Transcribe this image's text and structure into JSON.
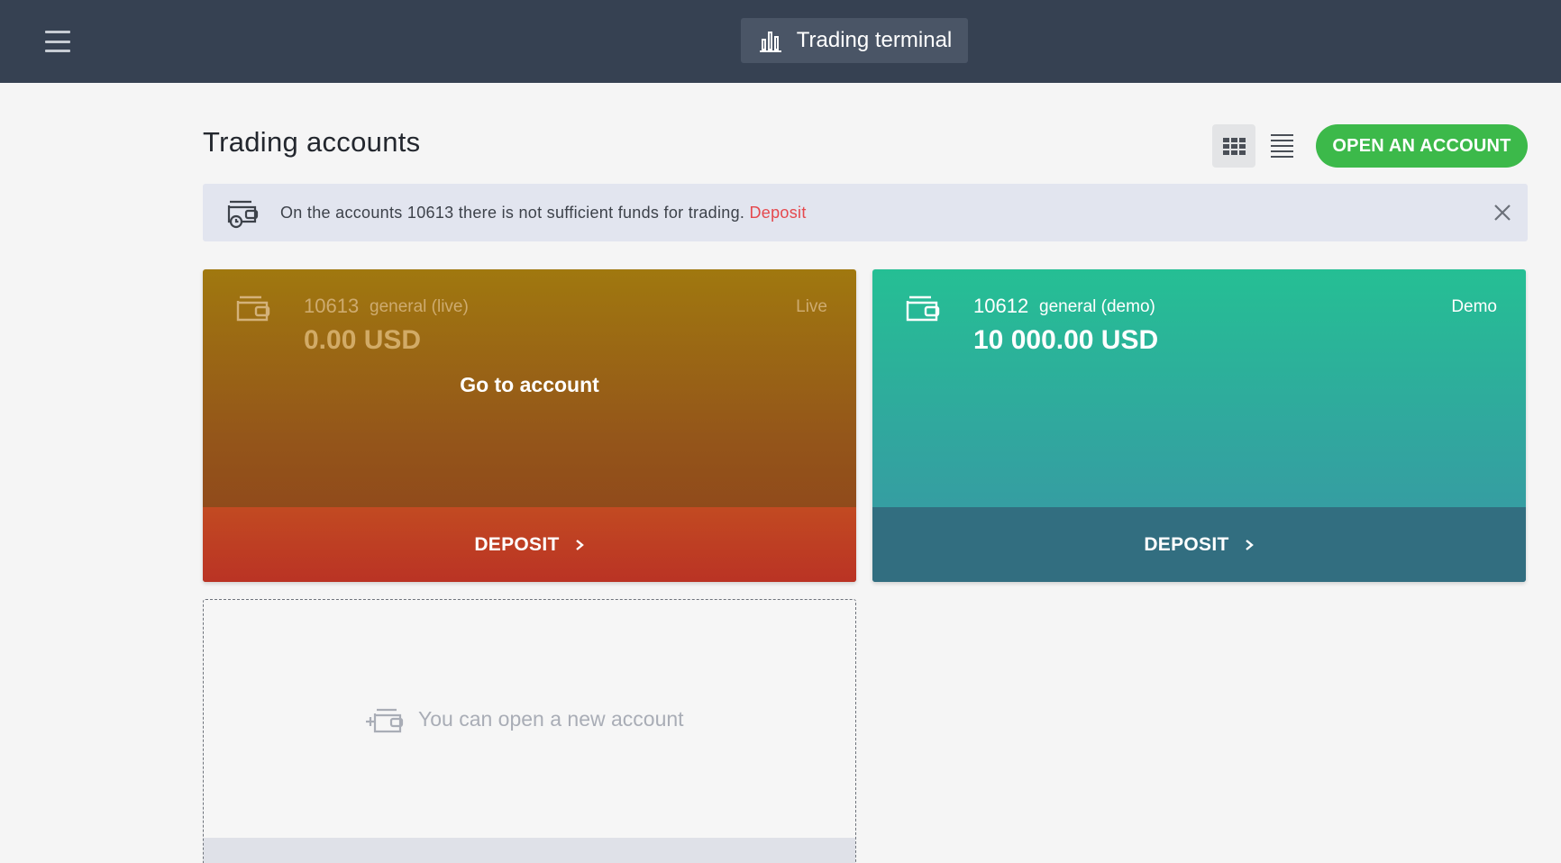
{
  "header": {
    "terminal_label": "Trading terminal"
  },
  "page": {
    "title": "Trading accounts",
    "open_account_label": "OPEN AN ACCOUNT"
  },
  "notice": {
    "text": "On the accounts 10613 there is not sufficient funds for trading. ",
    "link_label": "Deposit"
  },
  "accounts": [
    {
      "number": "10613",
      "type": "general (live)",
      "badge": "Live",
      "balance": "0.00 USD",
      "action_label": "Go to account",
      "deposit_label": "DEPOSIT"
    },
    {
      "number": "10612",
      "type": "general (demo)",
      "badge": "Demo",
      "balance": "10 000.00 USD",
      "deposit_label": "DEPOSIT"
    }
  ],
  "new_account": {
    "label": "You can open a new account"
  },
  "colors": {
    "header_bg": "#364152",
    "accent_green": "#3cb94a",
    "alert_red": "#e5484d"
  }
}
